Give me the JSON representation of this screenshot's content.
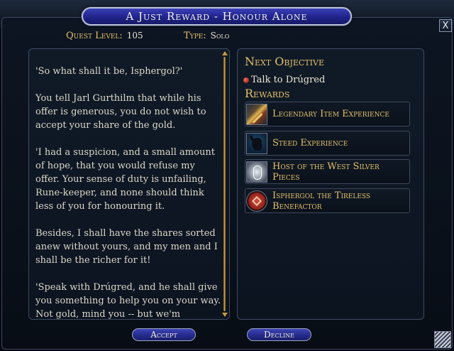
{
  "window": {
    "title": "A Just Reward - Honour Alone",
    "close_glyph": "X"
  },
  "quest": {
    "level_label": "Quest Level:",
    "level_value": "105",
    "type_label": "Type:",
    "type_value": "Solo"
  },
  "dialogue": {
    "paragraphs": [
      "'So what shall it be, Isphergol?'",
      "You tell Jarl Gurthilm that while his offer is generous, you do not wish to accept your share of the gold.",
      "'I had a suspicion, and a small amount of hope, that you would refuse my offer. Your sense of duty is unfailing, Rune-keeper, and none should think less of you for honouring it.",
      "Besides, I shall have the shares sorted anew without yours, and my men and I shall be the richer for it!",
      "'Speak with Drúgred, and he shall give you something to help you on your way. Not gold, mind you -- but we'm"
    ]
  },
  "objectives": {
    "heading": "Next Objective",
    "items": [
      "Talk to Drúgred"
    ]
  },
  "rewards": {
    "heading": "Rewards",
    "items": [
      {
        "label": "Legendary Item Experience",
        "icon": "legendary-item-icon"
      },
      {
        "label": "Steed Experience",
        "icon": "steed-icon"
      },
      {
        "label": "Host of the West Silver Pieces",
        "icon": "silver-pieces-icon"
      },
      {
        "label": "Isphergol the Tireless Benefactor",
        "icon": "title-emblem-icon"
      }
    ]
  },
  "buttons": {
    "accept": "Accept",
    "decline": "Decline"
  },
  "colors": {
    "heading_gold": "#e3c06a",
    "button_blue": "#252b8c",
    "bullet_red": "#c0392b"
  }
}
